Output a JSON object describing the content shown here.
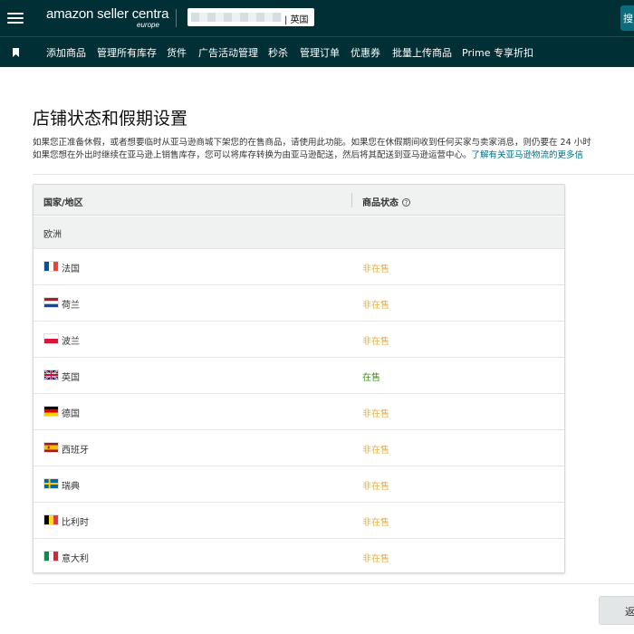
{
  "header": {
    "logo_text": "amazon seller centra",
    "logo_sub": "europe",
    "store_suffix": "| 英国",
    "corner_label": "搜"
  },
  "nav": {
    "items": [
      "添加商品",
      "管理所有库存",
      "货件",
      "广告活动管理",
      "秒杀",
      "管理订单",
      "优惠券",
      "批量上传商品",
      "Prime 专享折扣"
    ]
  },
  "page": {
    "title": "店铺状态和假期设置",
    "desc_line1": "如果您正准备休假，或者想要临时从亚马逊商城下架您的在售商品，请使用此功能。如果您在休假期间收到任何买家与卖家消息，则仍要在 24 小时",
    "desc_line2": "如果您想在外出时继续在亚马逊上销售库存，您可以将库存转换为由亚马逊配送，然后将其配送到亚马逊运营中心。",
    "desc_link": "了解有关亚马逊物流的更多信"
  },
  "table": {
    "col_country": "国家/地区",
    "col_status": "商品状态",
    "group": "欧洲",
    "rows": [
      {
        "country": "法国",
        "status": "非在售",
        "flag": "fr"
      },
      {
        "country": "荷兰",
        "status": "非在售",
        "flag": "nl"
      },
      {
        "country": "波兰",
        "status": "非在售",
        "flag": "pl"
      },
      {
        "country": "英国",
        "status": "在售",
        "flag": "gb"
      },
      {
        "country": "德国",
        "status": "非在售",
        "flag": "de"
      },
      {
        "country": "西班牙",
        "status": "非在售",
        "flag": "es"
      },
      {
        "country": "瑞典",
        "status": "非在售",
        "flag": "se"
      },
      {
        "country": "比利时",
        "status": "非在售",
        "flag": "be"
      },
      {
        "country": "意大利",
        "status": "非在售",
        "flag": "it"
      }
    ]
  },
  "footer": {
    "back_label": "返"
  },
  "colors": {
    "header_bg": "#002f36",
    "status_off": "#e2b04d",
    "status_on": "#4a8c2a",
    "link": "#007185"
  }
}
